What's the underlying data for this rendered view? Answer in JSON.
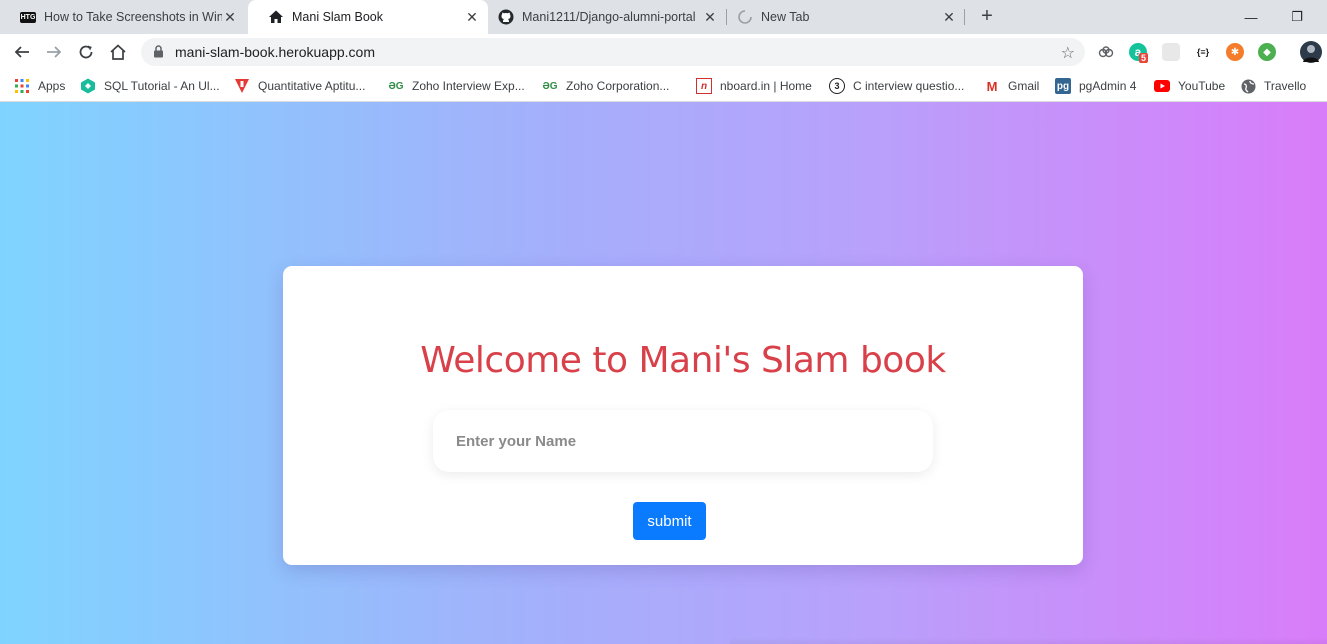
{
  "browser": {
    "tabs": [
      {
        "title": "How to Take Screenshots in Windows",
        "favicon": "htg-logo-icon",
        "active": false
      },
      {
        "title": "Mani Slam Book",
        "favicon": "home-icon",
        "active": true
      },
      {
        "title": "Mani1211/Django-alumni-portal",
        "favicon": "github-icon",
        "active": false
      },
      {
        "title": "New Tab",
        "favicon": "loading-spinner-icon",
        "active": false
      }
    ],
    "htg_badge": "HTG",
    "close_glyph": "✕",
    "new_tab_glyph": "+",
    "minimize_glyph": "—",
    "restore_glyph": "❐",
    "url": "mani-slam-book.herokuapp.com",
    "extension_badge_count": "5",
    "ext_json_label": "{≡}"
  },
  "bookmarks": [
    {
      "label": "Apps",
      "icon": "apps-grid-icon"
    },
    {
      "label": "SQL Tutorial - An Ul...",
      "icon": "sql-icon"
    },
    {
      "label": "Quantitative Aptitu...",
      "icon": "indiabix-icon"
    },
    {
      "label": "Zoho Interview Exp...",
      "icon": "gfg-icon"
    },
    {
      "label": "Zoho Corporation...",
      "icon": "gfg-icon"
    },
    {
      "label": "nboard.in | Home",
      "icon": "nboard-icon"
    },
    {
      "label": "C interview questio...",
      "icon": "c-icon"
    },
    {
      "label": "Gmail",
      "icon": "gmail-icon"
    },
    {
      "label": "pgAdmin 4",
      "icon": "pgadmin-icon"
    },
    {
      "label": "YouTube",
      "icon": "youtube-icon"
    },
    {
      "label": "Travello",
      "icon": "globe-icon"
    }
  ],
  "bookmark_glyphs": {
    "gfg": "ƏG",
    "nboard": "n",
    "c": "3",
    "gmail": "M",
    "pgadmin": "pg"
  },
  "page": {
    "heading": "Welcome to Mani's Slam book",
    "name_placeholder": "Enter your Name",
    "name_value": "",
    "submit_label": "submit"
  },
  "colors": {
    "heading": "#d9414a",
    "submit_bg": "#0a7bff",
    "gradient_start": "#7fd4ff",
    "gradient_end": "#d97cf9"
  }
}
